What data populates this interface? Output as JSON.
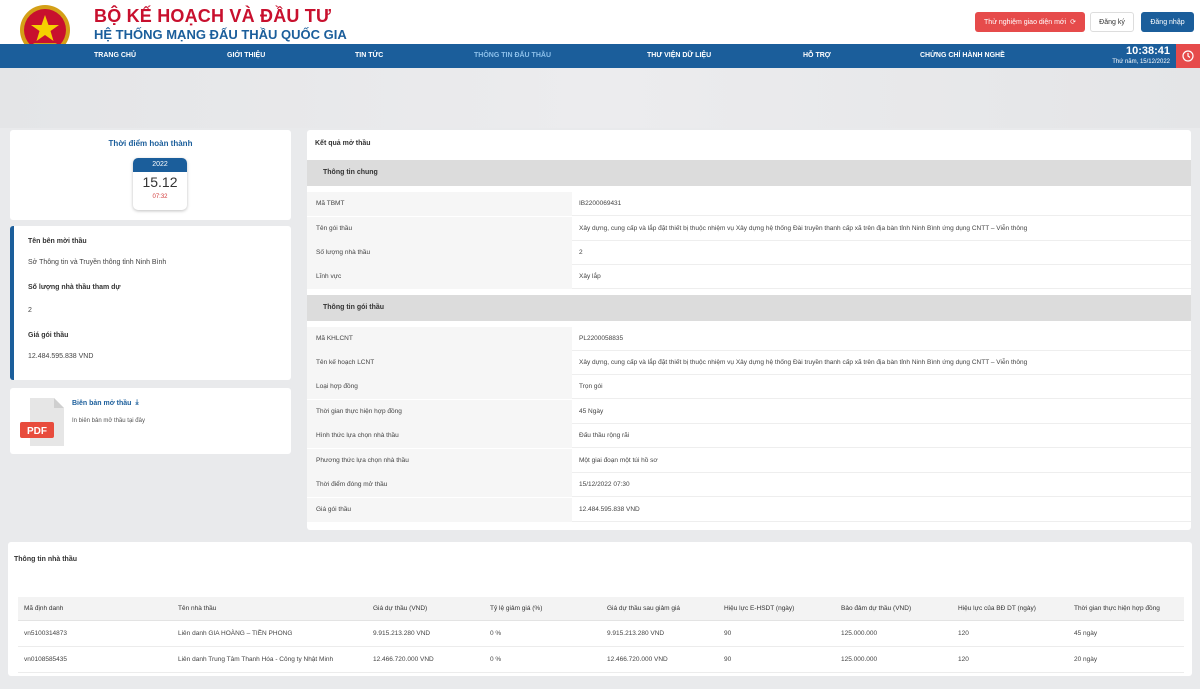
{
  "header": {
    "ministry": "BỘ KẾ HOẠCH VÀ ĐẦU TƯ",
    "system": "HỆ THỐNG MẠNG ĐẤU THẦU QUỐC GIA",
    "try_new_ui": "Thử nghiệm giao diện mới",
    "register": "Đăng ký",
    "login": "Đăng nhập"
  },
  "nav": {
    "items": [
      "TRANG CHỦ",
      "GIỚI THIỆU",
      "TIN TỨC",
      "THÔNG TIN ĐẤU THẦU",
      "THƯ VIỆN DỮ LIỆU",
      "HỖ TRỢ",
      "CHỨNG CHỈ HÀNH NGHỀ"
    ],
    "active": "THÔNG TIN ĐẤU THẦU",
    "clock_time": "10:38:41",
    "clock_date": "Thứ năm, 15/12/2022"
  },
  "completion": {
    "title": "Thời điểm hoàn thành",
    "year": "2022",
    "day": "15.12",
    "time": "07:32"
  },
  "summary": {
    "inviter_label": "Tên bên mời thầu",
    "inviter_value": "Sở Thông tin và Truyền thông tỉnh Ninh Bình",
    "bidders_label": "Số lượng nhà thầu tham dự",
    "bidders_value": "2",
    "price_label": "Giá gói thầu",
    "price_value": "12.484.595.838 VND"
  },
  "doc": {
    "title": "Biên bản mở thầu",
    "subtitle": "In biên bản mở thầu tại đây",
    "icon_label": "PDF"
  },
  "result": {
    "title": "Kết quả mở thầu",
    "general_head": "Thông tin chung",
    "general": [
      {
        "label": "Mã TBMT",
        "value": "IB2200069431"
      },
      {
        "label": "Tên gói thầu",
        "value": "Xây dựng, cung cấp và lắp đặt thiết bị thuộc nhiệm vụ Xây dựng hệ thống Đài truyền thanh cấp xã trên địa bàn tỉnh Ninh Bình ứng dụng CNTT – Viễn thông"
      },
      {
        "label": "Số lượng nhà thầu",
        "value": "2"
      },
      {
        "label": "Lĩnh vực",
        "value": "Xây lắp"
      }
    ],
    "package_head": "Thông tin gói thầu",
    "package": [
      {
        "label": "Mã KHLCNT",
        "value": "PL2200058835"
      },
      {
        "label": "Tên kế hoạch LCNT",
        "value": "Xây dựng, cung cấp và lắp đặt thiết bị thuộc nhiệm vụ Xây dựng hệ thống Đài truyền thanh cấp xã trên địa bàn tỉnh Ninh Bình ứng dụng CNTT – Viễn thông"
      },
      {
        "label": "Loại hợp đồng",
        "value": "Trọn gói"
      },
      {
        "label": "Thời gian thực hiện hợp đồng",
        "value": "45 Ngày"
      },
      {
        "label": "Hình thức lựa chọn nhà thầu",
        "value": "Đấu thầu rộng rãi"
      },
      {
        "label": "Phương thức lựa chọn nhà thầu",
        "value": "Một giai đoạn một túi hồ sơ"
      },
      {
        "label": "Thời điểm đóng mở thầu",
        "value": "15/12/2022 07:30"
      },
      {
        "label": "Giá gói thầu",
        "value": "12.484.595.838 VND"
      }
    ]
  },
  "contractors": {
    "title": "Thông tin nhà thầu",
    "columns": [
      "Mã định danh",
      "Tên nhà thầu",
      "Giá dự thầu (VND)",
      "Tỷ lệ giảm giá (%)",
      "Giá dự thầu sau giảm giá",
      "Hiệu lực E-HSDT (ngày)",
      "Bảo đảm dự thầu (VND)",
      "Hiệu lực của BĐ DT (ngày)",
      "Thời gian thực hiện hợp đồng"
    ],
    "rows": [
      [
        "vn5100314873",
        "Liên danh GIA HOÀNG – TIỀN PHONG",
        "9.915.213.280 VND",
        "0 %",
        "9.915.213.280 VND",
        "90",
        "125.000.000",
        "120",
        "45 ngày"
      ],
      [
        "vn0108585435",
        "Liên danh Trung Tâm Thanh Hóa - Công ty Nhật Minh",
        "12.466.720.000 VND",
        "0 %",
        "12.466.720.000 VND",
        "90",
        "125.000.000",
        "120",
        "20 ngày"
      ]
    ]
  },
  "colors": {
    "primary": "#1b5e9b",
    "accent_red": "#c8102e",
    "button_red": "#e64b4b"
  }
}
